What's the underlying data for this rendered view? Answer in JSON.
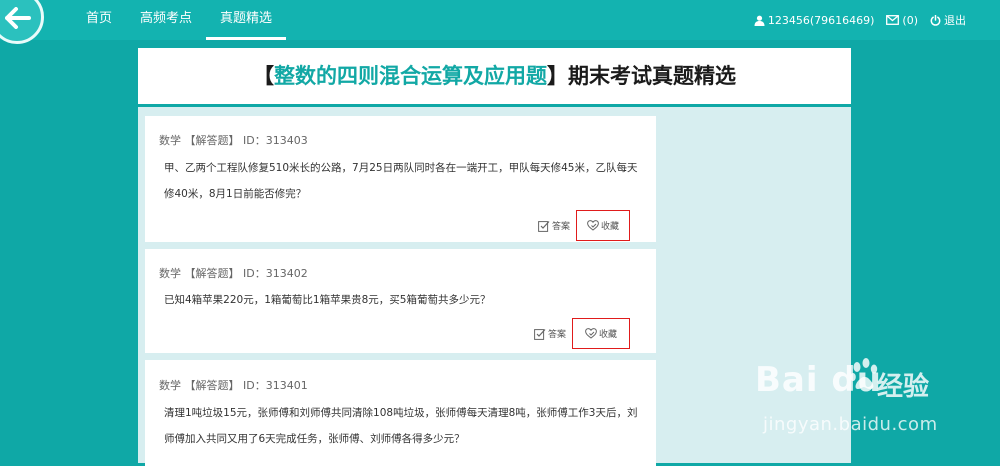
{
  "nav": {
    "items": [
      {
        "label": "首页",
        "active": false
      },
      {
        "label": "高频考点",
        "active": false
      },
      {
        "label": "真题精选",
        "active": true
      }
    ]
  },
  "user": {
    "account": "123456(79616469)",
    "messages": "(0)",
    "logout": "退出"
  },
  "banner": {
    "bracket_open": "【",
    "highlight": "整数的四则混合运算及应用题",
    "bracket_close": "】",
    "suffix": "期末考试真题精选"
  },
  "questions": [
    {
      "meta": "数学 【解答题】 ID：313403",
      "text": "甲、乙两个工程队修复510米长的公路，7月25日两队同时各在一端开工，甲队每天修45米，乙队每天修40米，8月1日前能否修完？",
      "answer_label": "答案",
      "favorite_label": "收藏"
    },
    {
      "meta": "数学 【解答题】 ID：313402",
      "text": "已知4箱苹果220元，1箱葡萄比1箱苹果贵8元，买5箱葡萄共多少元？",
      "answer_label": "答案",
      "favorite_label": "收藏"
    },
    {
      "meta": "数学 【解答题】 ID：313401",
      "text": "清理1吨垃圾15元，张师傅和刘师傅共同清除108吨垃圾，张师傅每天清理8吨，张师傅工作3天后，刘师傅加入共同又用了6天完成任务，张师傅、刘师傅各得多少元？"
    }
  ],
  "watermark": {
    "brand": "Bai  du",
    "product": "经验",
    "url": "jingyan.baidu.com"
  },
  "colors": {
    "teal_background": "#0fa8a6",
    "topbar": "#13b3b0",
    "highlight": "#12a8a5",
    "annotation_red": "#e01b1b"
  }
}
